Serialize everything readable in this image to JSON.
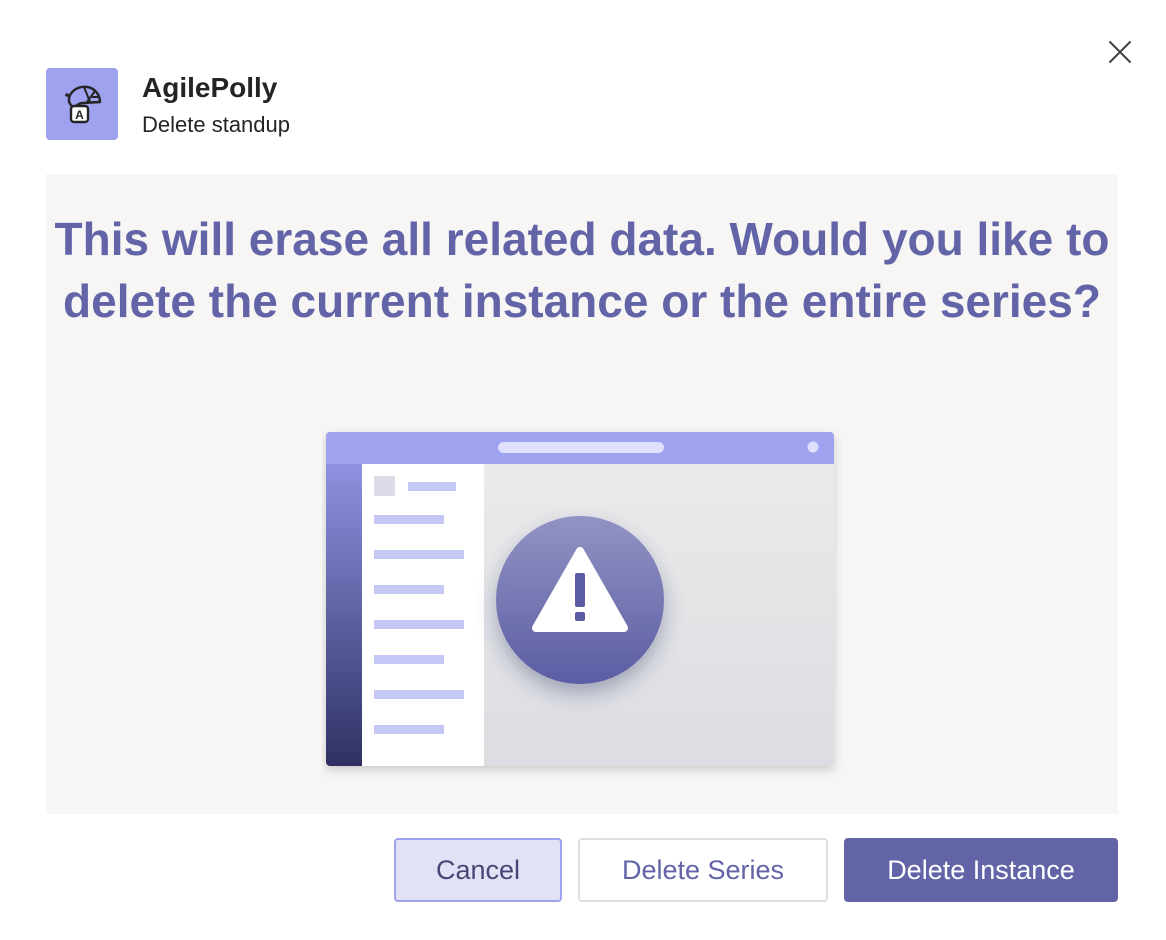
{
  "header": {
    "app_name": "AgilePolly",
    "subtitle": "Delete standup",
    "app_icon": "agilepolly-logo-icon",
    "close_icon": "close-icon"
  },
  "content": {
    "message": "This will erase all related data. Would you like to delete the current instance or the entire series?",
    "illustration_icon": "warning-icon"
  },
  "actions": {
    "cancel_label": "Cancel",
    "delete_series_label": "Delete Series",
    "delete_instance_label": "Delete Instance"
  },
  "colors": {
    "accent": "#6264a7",
    "accent_light": "#9ea2ef",
    "panel_background": "#f7f6f5",
    "text_dark": "#242424"
  }
}
